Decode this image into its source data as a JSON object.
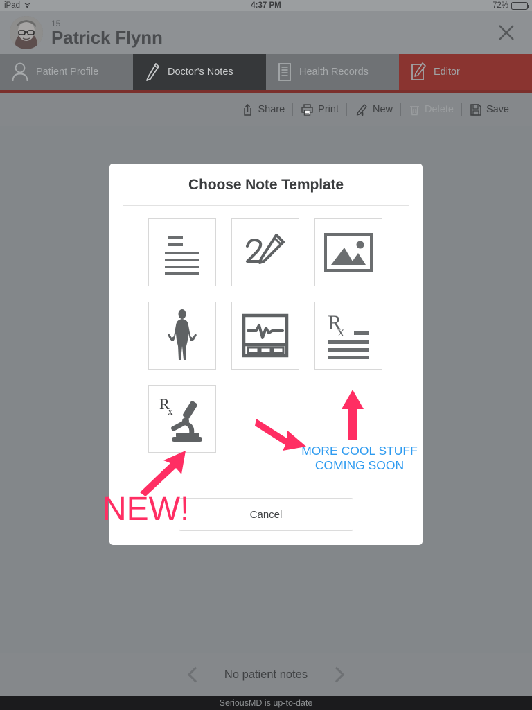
{
  "status_bar": {
    "device": "iPad",
    "wifi_icon": "wifi-icon",
    "time": "4:37 PM",
    "battery_percent": "72%",
    "battery_icon": "battery-icon"
  },
  "patient_header": {
    "avatar_icon": "avatar",
    "age": "15",
    "name": "Patrick Flynn",
    "close_icon": "close-icon"
  },
  "tabs": [
    {
      "label": "Patient Profile",
      "icon": "person-icon",
      "state": "inactive"
    },
    {
      "label": "Doctor's Notes",
      "icon": "pencil-icon",
      "state": "active"
    },
    {
      "label": "Health Records",
      "icon": "records-icon",
      "state": "inactive"
    },
    {
      "label": "Editor",
      "icon": "note-edit-icon",
      "state": "accent"
    }
  ],
  "toolbar": [
    {
      "label": "Share",
      "icon": "share-icon",
      "disabled": false
    },
    {
      "label": "Print",
      "icon": "printer-icon",
      "disabled": false
    },
    {
      "label": "New",
      "icon": "pencil-plus-icon",
      "disabled": false
    },
    {
      "label": "Delete",
      "icon": "trash-icon",
      "disabled": true
    },
    {
      "label": "Save",
      "icon": "floppy-disk-icon",
      "disabled": false
    }
  ],
  "modal": {
    "title": "Choose Note Template",
    "templates": [
      {
        "name": "text-note-template",
        "icon": "lines-icon"
      },
      {
        "name": "drawing-note-template",
        "icon": "scribble-pencil-icon"
      },
      {
        "name": "image-note-template",
        "icon": "picture-icon"
      },
      {
        "name": "body-chart-template",
        "icon": "human-body-icon"
      },
      {
        "name": "vitals-template",
        "icon": "ecg-monitor-icon"
      },
      {
        "name": "prescription-template",
        "icon": "rx-lines-icon"
      },
      {
        "name": "lab-request-template",
        "icon": "rx-microscope-icon"
      }
    ],
    "cancel_label": "Cancel"
  },
  "annotations": {
    "new_label": "NEW!",
    "coming_soon_line1": "MORE COOL STUFF",
    "coming_soon_line2": "COMING SOON",
    "pink": "#ff2e63",
    "blue": "#2e9bf0",
    "arrows": [
      "arrow-up-right-icon",
      "arrow-up-left-icon",
      "arrow-up-icon"
    ]
  },
  "bottom_nav": {
    "prev_icon": "chevron-left-icon",
    "label": "No patient notes",
    "next_icon": "chevron-right-icon"
  },
  "footer": {
    "sync_status": "SeriousMD is up-to-date"
  },
  "colors": {
    "overlay": "#83878a",
    "accent_red": "#8a3430",
    "tab_active": "#36383a",
    "modal_bg": "#ffffff"
  }
}
